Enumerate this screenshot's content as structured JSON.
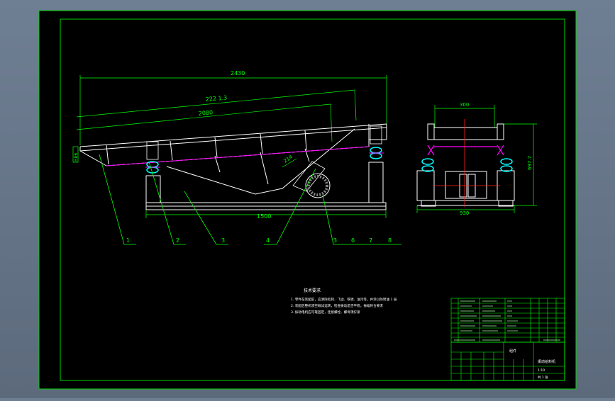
{
  "dimensions": {
    "overall_length": "2430",
    "deck_length": "222 1.3",
    "inner_length": "2080",
    "spring_span": "1500",
    "motor_offset": "214",
    "height_label": "H86",
    "end_top_width": "300",
    "end_bottom_width": "930",
    "end_height": "697.7"
  },
  "callouts": [
    "1",
    "2",
    "3",
    "4",
    "3",
    "6",
    "7",
    "8"
  ],
  "notes": {
    "heading": "技术要求",
    "items": [
      "1. 零件在装配前，应清除毛刺、飞边、铁锈、油污等，并涂以防锈油 1 层",
      "2. 装配后整机须空载试运转，检查振动是否平稳，振幅符合要求",
      "3. 振动电机应可靠固定，连接螺栓、螺母须拧紧"
    ]
  },
  "title_block": {
    "drawing_title": "振动给料机",
    "scale": "1:10",
    "material": "组件",
    "sheet": "共 1 张"
  },
  "colors": {
    "frame": "#00d200",
    "outline": "#ffffff",
    "dimension": "#00ff00",
    "spring": "#00ffff",
    "centerline": "#ff2020",
    "highlight": "#ff00ff"
  }
}
